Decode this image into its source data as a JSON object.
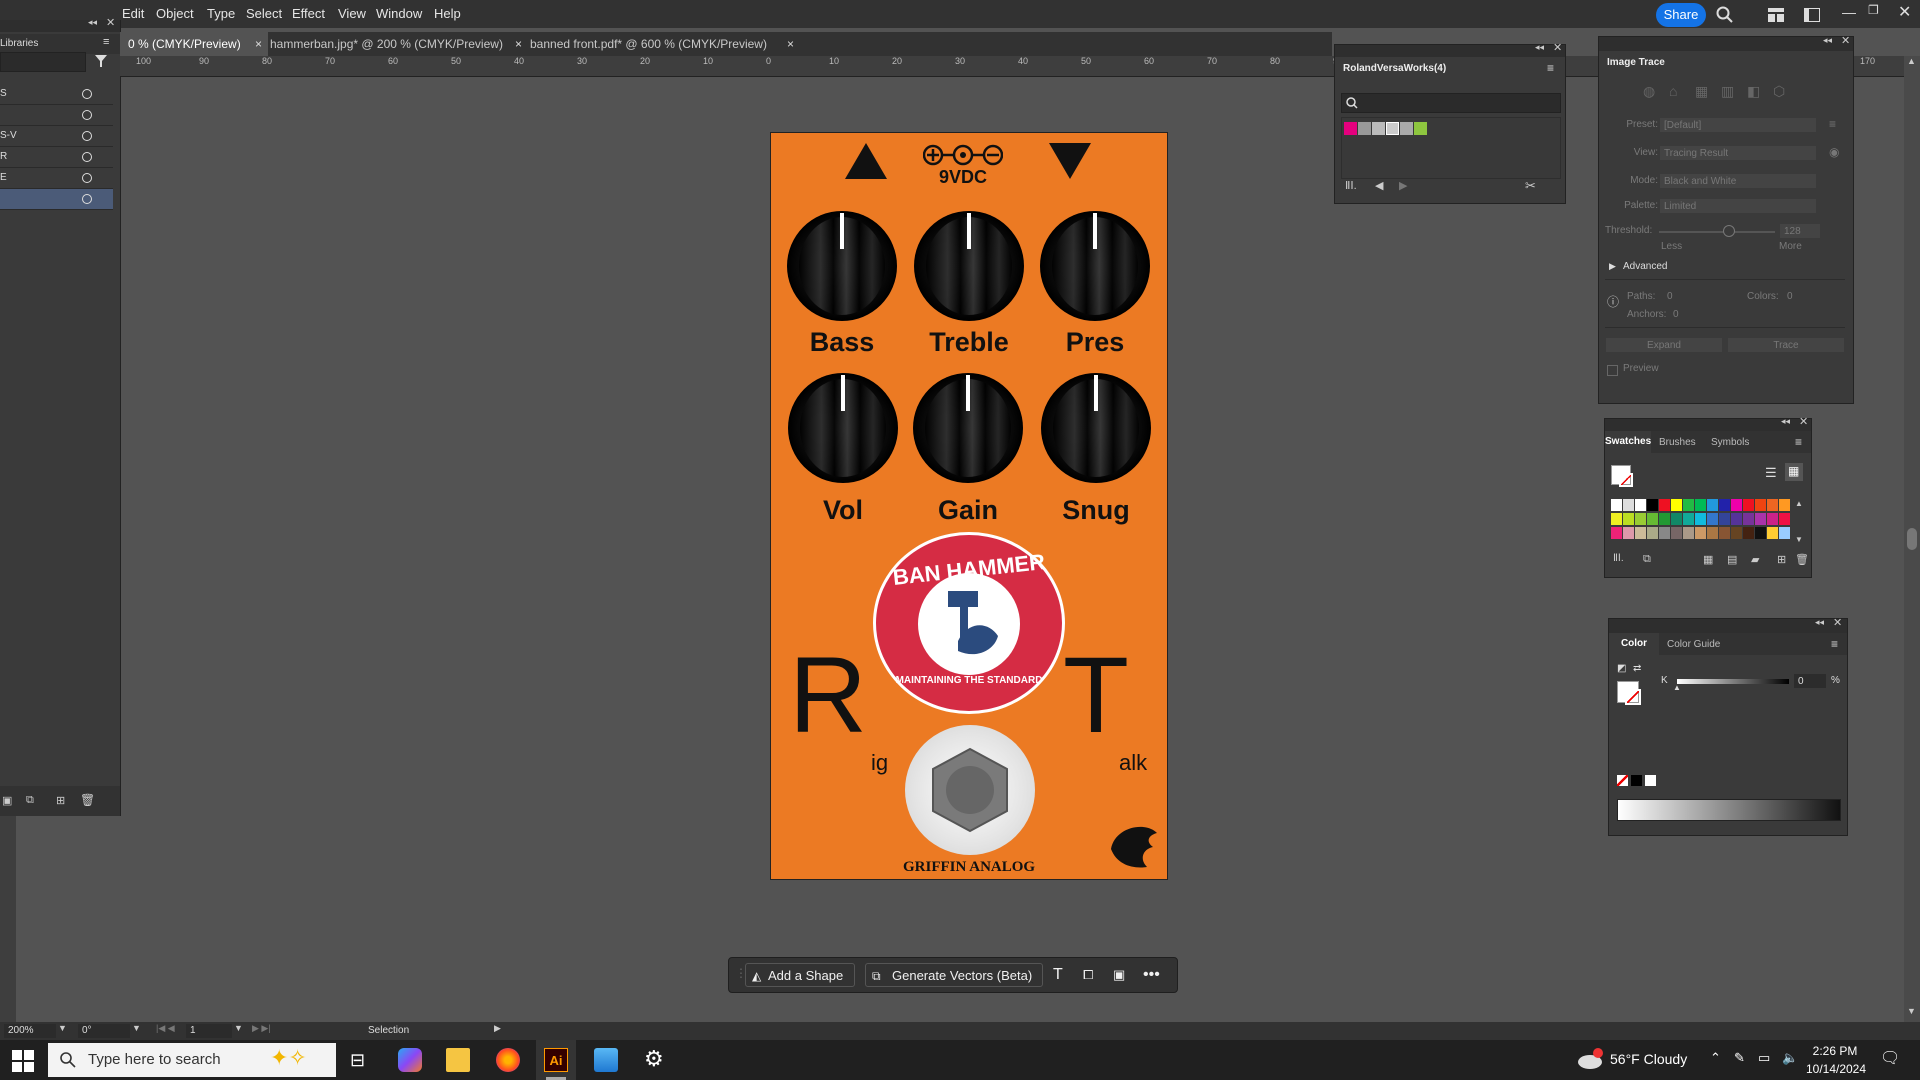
{
  "menu": [
    "Edit",
    "Object",
    "Type",
    "Select",
    "Effect",
    "View",
    "Window",
    "Help"
  ],
  "share_label": "Share",
  "tabs": [
    {
      "label": "0 % (CMYK/Preview)"
    },
    {
      "label": "hammerban.jpg* @ 200 % (CMYK/Preview)"
    },
    {
      "label": "banned front.pdf* @ 600 % (CMYK/Preview)"
    }
  ],
  "tab_close": "×",
  "ruler_ticks": [
    "100",
    "90",
    "80",
    "70",
    "60",
    "50",
    "40",
    "30",
    "20",
    "10",
    "0",
    "10",
    "20",
    "30",
    "40",
    "50",
    "60",
    "70",
    "80",
    "90",
    "170"
  ],
  "libraries": {
    "title": "Libraries",
    "layers": [
      "S",
      "",
      "S-V",
      "R",
      "E",
      ""
    ]
  },
  "pedal": {
    "power_label": "9VDC",
    "knobs_row1": [
      "Bass",
      "Treble",
      "Pres"
    ],
    "knobs_row2": [
      "Vol",
      "Gain",
      "Snug"
    ],
    "logo_top": "BAN HAMMER",
    "logo_bottom": "MAINTAINING THE STANDARD",
    "big_left": "R",
    "small_left": "ig",
    "big_right": "T",
    "small_right": "alk",
    "brand": "GRIFFIN ANALOG"
  },
  "swatch_panel_roland": {
    "title": "RolandVersaWorks(4)"
  },
  "image_trace": {
    "title": "Image Trace",
    "preset_label": "Preset:",
    "preset_value": "[Default]",
    "view_label": "View:",
    "view_value": "Tracing Result",
    "mode_label": "Mode:",
    "mode_value": "Black and White",
    "palette_label": "Palette:",
    "palette_value": "Limited",
    "threshold_label": "Threshold:",
    "threshold_value": "128",
    "less": "Less",
    "more": "More",
    "advanced": "Advanced",
    "paths": "Paths:",
    "paths_value": "0",
    "colors": "Colors:",
    "colors_value": "0",
    "anchors": "Anchors:",
    "anchors_value": "0",
    "expand": "Expand",
    "trace": "Trace",
    "preview": "Preview"
  },
  "swatches_panel": {
    "tabs": [
      "Swatches",
      "Brushes",
      "Symbols"
    ]
  },
  "color_panel": {
    "tabs": [
      "Color",
      "Color Guide"
    ],
    "k_label": "K",
    "k_value": "0",
    "unit": "%"
  },
  "context_bar": {
    "add_shape": "Add a Shape",
    "generate": "Generate Vectors (Beta)"
  },
  "status": {
    "zoom": "200%",
    "rotate": "0°",
    "page": "1",
    "tool": "Selection"
  },
  "taskbar": {
    "search_placeholder": "Type here to search",
    "weather": "56°F  Cloudy",
    "time": "2:26 PM",
    "date": "10/14/2024"
  },
  "colors": {
    "accent": "#1473e6",
    "pedal": "#ec7a23",
    "logo_red": "#d52c44"
  }
}
